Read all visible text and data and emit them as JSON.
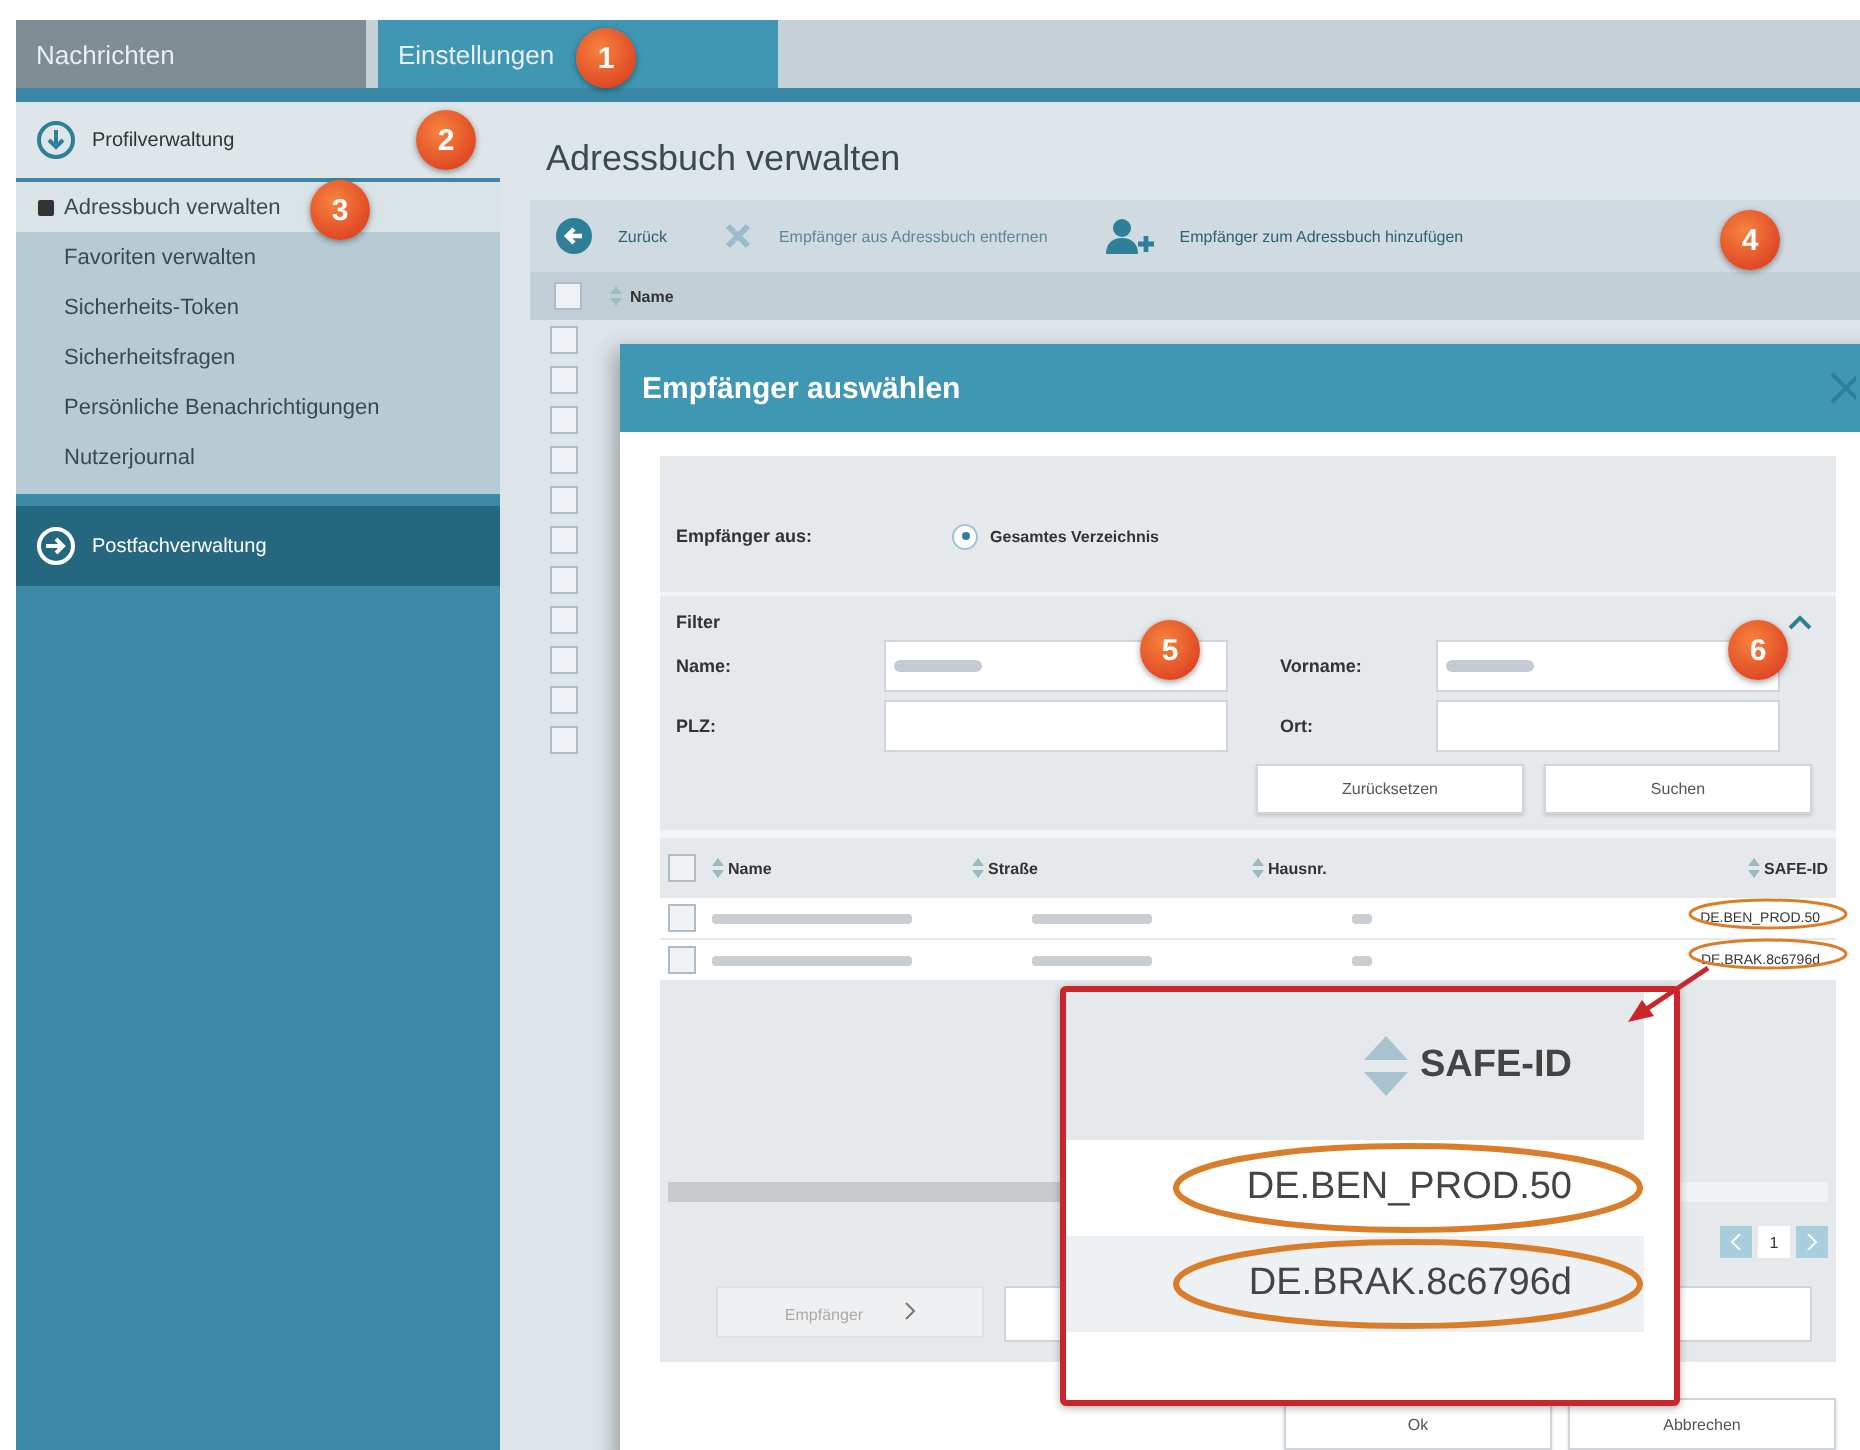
{
  "tabs": [
    {
      "label": "Nachrichten",
      "selected": false
    },
    {
      "label": "Einstellungen",
      "selected": true
    }
  ],
  "sidebar": {
    "sections": [
      {
        "label": "Profilverwaltung",
        "expanded": true,
        "children": [
          {
            "label": "Adressbuch verwalten",
            "selected": true
          },
          {
            "label": "Favoriten verwalten",
            "selected": false
          },
          {
            "label": "Sicherheits-Token",
            "selected": false
          },
          {
            "label": "Sicherheitsfragen",
            "selected": false
          },
          {
            "label": "Persönliche Benachrichtigungen",
            "selected": false
          },
          {
            "label": "Nutzerjournal",
            "selected": false
          }
        ]
      },
      {
        "label": "Postfachverwaltung",
        "expanded": false
      }
    ]
  },
  "page": {
    "title": "Adressbuch verwalten",
    "toolbar": [
      {
        "label": "Zurück",
        "kind": "back",
        "disabled": false
      },
      {
        "label": "Empfänger aus Adressbuch entfernen",
        "kind": "remove",
        "disabled": true
      },
      {
        "label": "Empfänger zum Adressbuch hinzufügen",
        "kind": "add",
        "disabled": false
      }
    ],
    "table": {
      "columns": [
        "Name"
      ],
      "all_checked": false,
      "rows": [
        {
          "checked": false
        },
        {
          "checked": false
        },
        {
          "checked": false
        },
        {
          "checked": false
        },
        {
          "checked": false
        },
        {
          "checked": false
        },
        {
          "checked": false
        },
        {
          "checked": false
        },
        {
          "checked": false
        },
        {
          "checked": false
        },
        {
          "checked": false
        }
      ]
    }
  },
  "dialog": {
    "title": "Empfänger auswählen",
    "source": {
      "label": "Empfänger aus:",
      "options": [
        {
          "label": "Gesamtes Verzeichnis",
          "selected": true
        }
      ]
    },
    "filter": {
      "title": "Filter",
      "fields": [
        {
          "label": "Name:",
          "redacted": true
        },
        {
          "label": "Vorname:",
          "redacted": true
        },
        {
          "label": "PLZ:",
          "redacted": false
        },
        {
          "label": "Ort:",
          "redacted": false
        }
      ],
      "buttons": [
        "Zurücksetzen",
        "Suchen"
      ]
    },
    "results": {
      "columns": [
        "Name",
        "Straße",
        "Hausnr.",
        "SAFE-ID"
      ],
      "all_checked": false,
      "rows": [
        {
          "safe_id": "DE.BEN_PROD.50",
          "selected": false
        },
        {
          "safe_id": "DE.BRAK.8c6796d",
          "selected": false
        }
      ]
    },
    "pagination": {
      "page": "1"
    },
    "step_button": "Empfänger",
    "buttons": [
      "Ok",
      "Abbrechen"
    ]
  },
  "callout": {
    "column": "SAFE-ID",
    "rows": [
      "DE.BEN_PROD.50",
      "DE.BRAK.8c6796d"
    ]
  },
  "markers": [
    "1",
    "2",
    "3",
    "4",
    "5",
    "6"
  ]
}
